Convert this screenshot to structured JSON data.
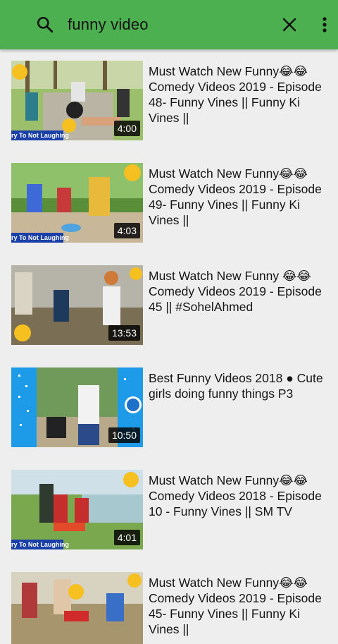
{
  "search": {
    "query": "funny video"
  },
  "icons": {
    "search": "search-icon",
    "clear": "close-icon",
    "more": "more-vert-icon"
  },
  "colors": {
    "toolbar": "#4caf50",
    "background": "#eeeeee"
  },
  "results": [
    {
      "title": "Must Watch New Funny😂😂Comedy Videos 2019 - Episode 48- Funny Vines || Funny Ki Vines ||",
      "duration": "4:00",
      "thumb_caption": "ry To Not Laughing"
    },
    {
      "title": "Must Watch New Funny😂😂Comedy Videos 2019 - Episode 49- Funny Vines || Funny Ki Vines ||",
      "duration": "4:03",
      "thumb_caption": "ry To Not Laughing"
    },
    {
      "title": "Must Watch New Funny 😂😂 Comedy Videos 2019 - Episode 45 || #SohelAhmed",
      "duration": "13:53"
    },
    {
      "title": "Best Funny Videos 2018 ● Cute girls doing funny things P3",
      "duration": "10:50"
    },
    {
      "title": "Must Watch New Funny😂😂Comedy Videos 2018 - Episode 10 - Funny Vines || SM TV",
      "duration": "4:01",
      "thumb_caption": "ry To Not Laughing"
    },
    {
      "title": "Must Watch New Funny😂😂Comedy Videos 2019 - Episode 45- Funny Vines || Funny Ki Vines ||"
    }
  ]
}
